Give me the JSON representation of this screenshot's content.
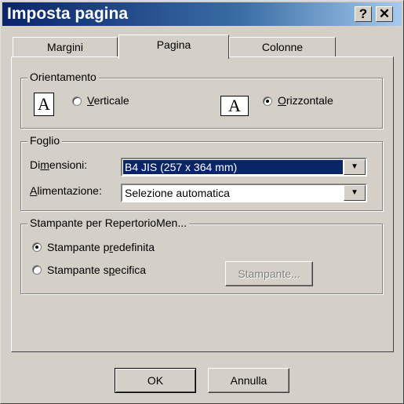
{
  "window": {
    "title": "Imposta pagina",
    "help_glyph": "?",
    "close_glyph": "✕"
  },
  "tabs": [
    {
      "label": "Margini"
    },
    {
      "label": "Pagina"
    },
    {
      "label": "Colonne"
    }
  ],
  "orientation": {
    "legend": "Orientamento",
    "icon_letter": "A",
    "portrait": {
      "label": "Verticale",
      "selected": false
    },
    "landscape": {
      "label": "Orizzontale",
      "selected": true
    }
  },
  "paper": {
    "legend": "Foglio",
    "size_label": "Dimensioni:",
    "size_value": "B4 JIS (257 x 364 mm)",
    "source_label": "Alimentazione:",
    "source_value": "Selezione automatica",
    "arrow_glyph": "▼"
  },
  "printer": {
    "legend": "Stampante per RepertorioMen...",
    "default_label": "Stampante predefinita",
    "specific_label": "Stampante specifica",
    "selected": "default",
    "printer_button": "Stampante..."
  },
  "buttons": {
    "ok": "OK",
    "cancel": "Annulla"
  },
  "colors": {
    "titlebar_start": "#0a246a",
    "face": "#d4d0c8",
    "selection": "#0a246a"
  }
}
